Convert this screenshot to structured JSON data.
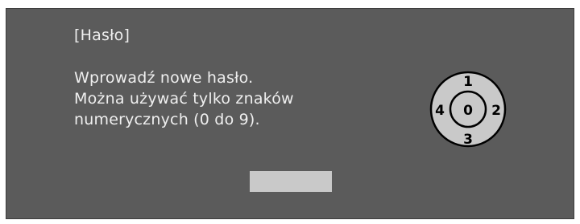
{
  "dialog": {
    "title": "[Hasło]",
    "message_lines": [
      "Wprowadź nowe hasło.",
      "Można używać tylko znaków",
      "numerycznych (0 do 9)."
    ]
  },
  "keypad": {
    "icon": "remote-numeric-keypad-icon",
    "center": "0",
    "up": "1",
    "right": "2",
    "down": "3",
    "left": "4"
  },
  "password_field": {
    "value": ""
  },
  "colors": {
    "dialog_background": "#5b5b5b",
    "text": "#efefef",
    "field": "#c9c9c9",
    "keypad_fill": "#c9c9c9",
    "keypad_stroke": "#000000"
  }
}
